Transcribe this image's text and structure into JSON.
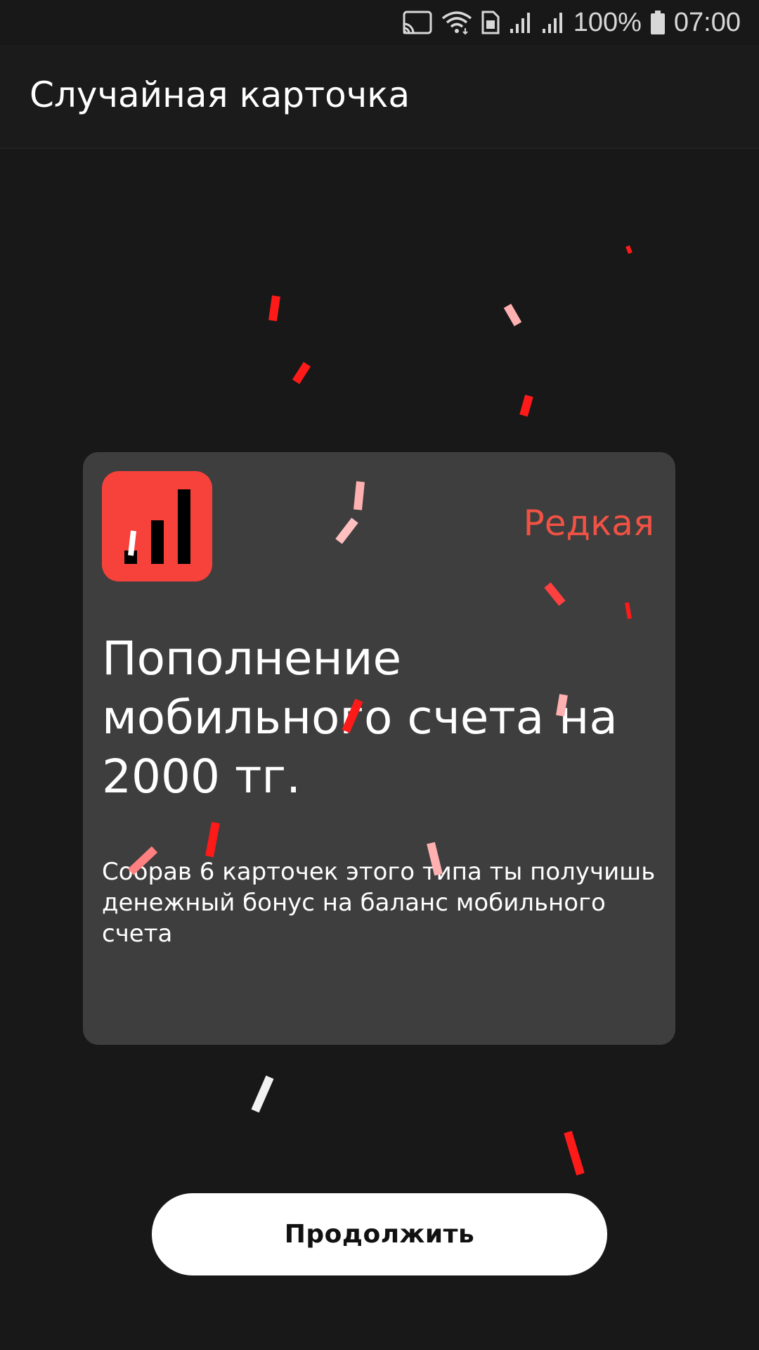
{
  "status_bar": {
    "battery": "100%",
    "time": "07:00",
    "icons": [
      "cast-icon",
      "wifi-icon",
      "sim-icon",
      "signal-icon",
      "signal-icon",
      "battery-icon"
    ]
  },
  "app_bar": {
    "title": "Случайная карточка"
  },
  "card": {
    "icon": "bar-chart-icon",
    "rarity": "Редкая",
    "title": "Пополнение мобильного счета на 2000 тг.",
    "description": "Собрав 6 карточек этого типа ты получишь денежный бонус на баланс мобильного счета"
  },
  "continue_button": {
    "label": "Продолжить"
  },
  "colors": {
    "background": "#181818",
    "card": "#3e3e3e",
    "accent": "#f7413b",
    "rarity": "#f25244",
    "confetti_red": "#ff1a1a",
    "confetti_pink": "#ffb0b0",
    "confetti_white": "#f2f2f2"
  }
}
